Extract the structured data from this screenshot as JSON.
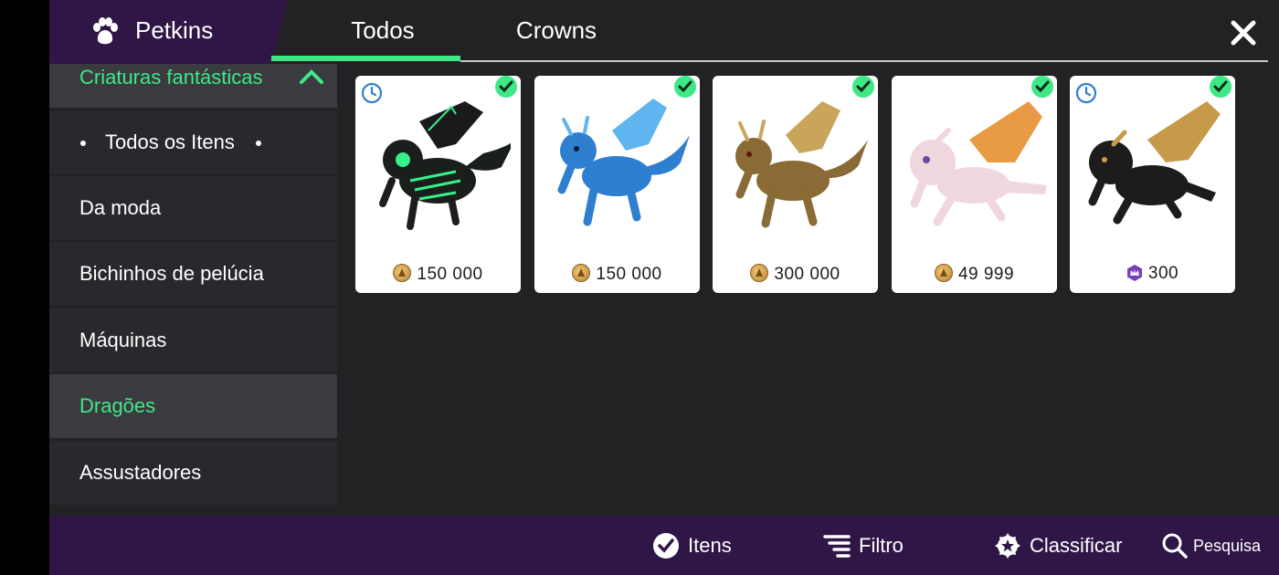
{
  "header": {
    "brand": "Petkins",
    "brand_icon": "paw-icon",
    "tabs": [
      {
        "label": "Todos",
        "active": true
      },
      {
        "label": "Crowns",
        "active": false
      }
    ],
    "close_icon": "close-icon"
  },
  "sidebar": {
    "category": "Criaturas fantásticas",
    "items": [
      {
        "label": "Todos os Itens"
      },
      {
        "label": "Da moda"
      },
      {
        "label": "Bichinhos de pelúcia"
      },
      {
        "label": "Máquinas"
      },
      {
        "label": "Dragões",
        "active": true
      },
      {
        "label": "Assustadores"
      }
    ]
  },
  "grid": {
    "items": [
      {
        "price": "150 000",
        "currency": "gold",
        "timed": true,
        "owned": true,
        "color": "#1a1f1c",
        "accent": "#38f08a"
      },
      {
        "price": "150 000",
        "currency": "gold",
        "timed": false,
        "owned": true,
        "color": "#2f7fd1",
        "accent": "#5fb5f0"
      },
      {
        "price": "300 000",
        "currency": "gold",
        "timed": false,
        "owned": true,
        "color": "#8a6a35",
        "accent": "#c9a55b"
      },
      {
        "price": "49 999",
        "currency": "gold",
        "timed": false,
        "owned": true,
        "color": "#f0d6dd",
        "accent": "#e89a45"
      },
      {
        "price": "300",
        "currency": "crowns",
        "timed": true,
        "owned": true,
        "color": "#1e1c1a",
        "accent": "#c79a4a"
      }
    ]
  },
  "bottom_bar": {
    "items_label": "Itens",
    "filter_label": "Filtro",
    "sort_label": "Classificar",
    "search_label": "Pesquisa"
  },
  "colors": {
    "accent_green": "#3ee886",
    "purple": "#2f1647",
    "panel": "#222225"
  }
}
